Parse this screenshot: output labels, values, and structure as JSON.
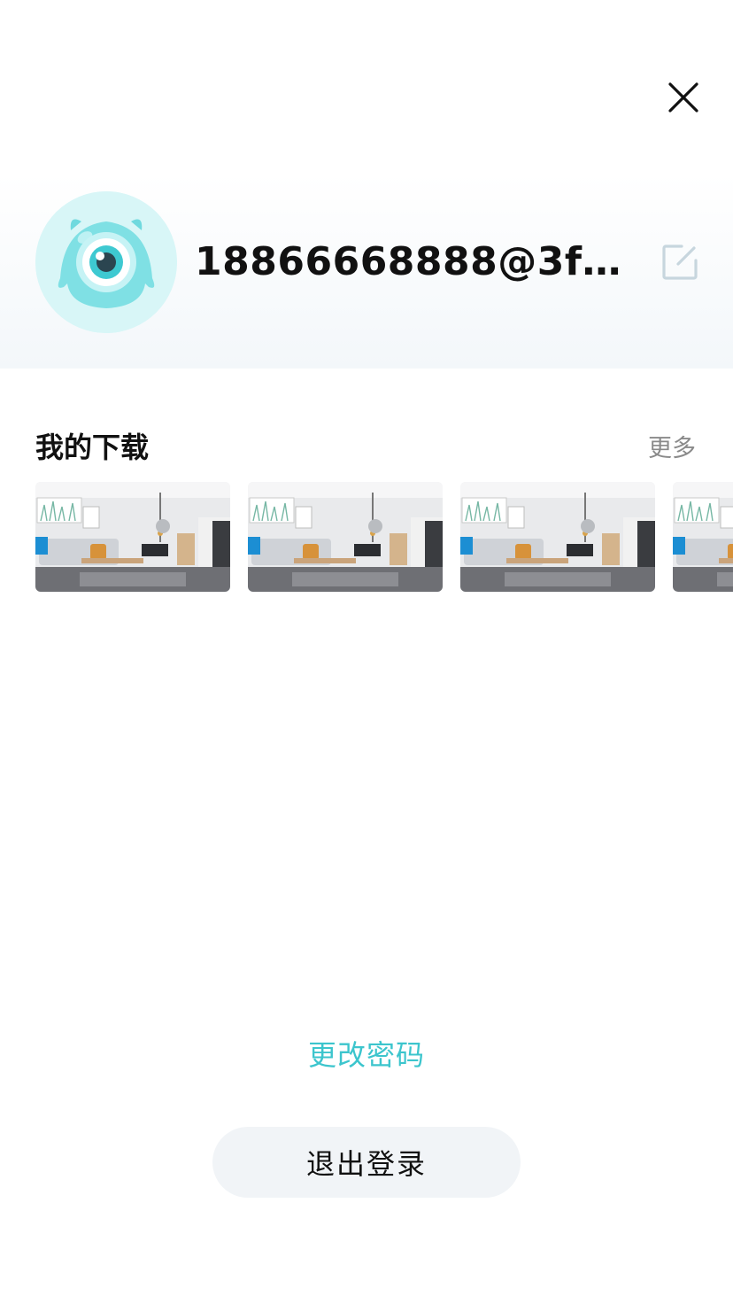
{
  "header": {
    "close_icon": "close-icon"
  },
  "profile": {
    "avatar_icon": "monster-eye-avatar",
    "username": "18866668888@3feer4...",
    "edit_icon": "edit-icon",
    "avatar_color": "#7fe0e4"
  },
  "downloads": {
    "title": "我的下载",
    "more_label": "更多",
    "items": [
      {
        "thumbnail": "living-room-render"
      },
      {
        "thumbnail": "living-room-render"
      },
      {
        "thumbnail": "living-room-render"
      },
      {
        "thumbnail": "living-room-render"
      }
    ]
  },
  "actions": {
    "change_password_label": "更改密码",
    "logout_label": "退出登录"
  },
  "colors": {
    "accent": "#3cc5cd",
    "button_bg": "#f1f4f7",
    "muted_text": "#8a8a8a"
  }
}
